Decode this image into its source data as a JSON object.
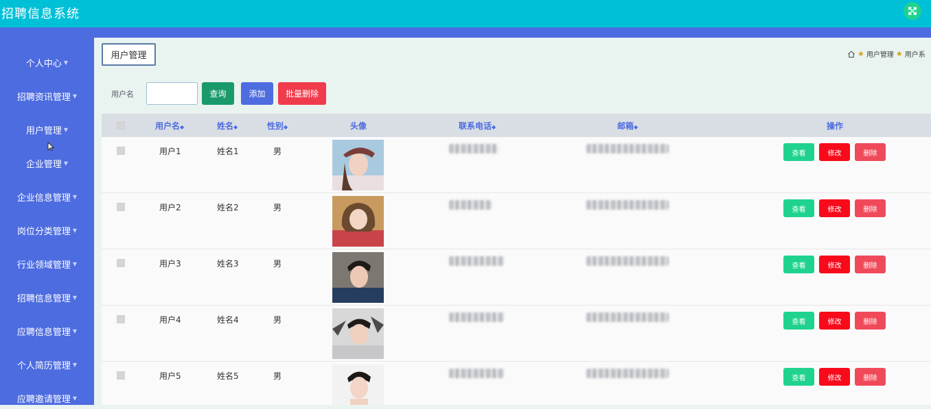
{
  "app": {
    "title": "招聘信息系统"
  },
  "sidebar": {
    "items": [
      {
        "label": "个人中心"
      },
      {
        "label": "招聘资讯管理"
      },
      {
        "label": "用户管理"
      },
      {
        "label": "企业管理"
      },
      {
        "label": "企业信息管理"
      },
      {
        "label": "岗位分类管理"
      },
      {
        "label": "行业领域管理"
      },
      {
        "label": "招聘信息管理"
      },
      {
        "label": "应聘信息管理"
      },
      {
        "label": "个人简历管理"
      },
      {
        "label": "应聘邀请管理"
      }
    ]
  },
  "main": {
    "page_tab": "用户管理",
    "breadcrumb": {
      "item1": "用户管理",
      "item2": "用户系"
    },
    "search": {
      "label": "用户名",
      "value": ""
    },
    "buttons": {
      "query": "查询",
      "add": "添加",
      "batch_delete": "批量删除"
    },
    "table": {
      "headers": [
        "用户名",
        "姓名",
        "性别",
        "头像",
        "联系电话",
        "邮箱",
        "操作"
      ],
      "rows": [
        {
          "username": "用户1",
          "name": "姓名1",
          "gender": "男"
        },
        {
          "username": "用户2",
          "name": "姓名2",
          "gender": "男"
        },
        {
          "username": "用户3",
          "name": "姓名3",
          "gender": "男"
        },
        {
          "username": "用户4",
          "name": "姓名4",
          "gender": "男"
        },
        {
          "username": "用户5",
          "name": "姓名5",
          "gender": "男"
        }
      ],
      "actions": {
        "view": "查看",
        "edit": "修改",
        "delete": "删除"
      }
    }
  },
  "colors": {
    "topbar": "#00c0d8",
    "sidebar": "#4d6ce0",
    "view_button": "#1fd38f",
    "edit_button": "#f70b1b",
    "delete_button": "#f04a5a"
  }
}
